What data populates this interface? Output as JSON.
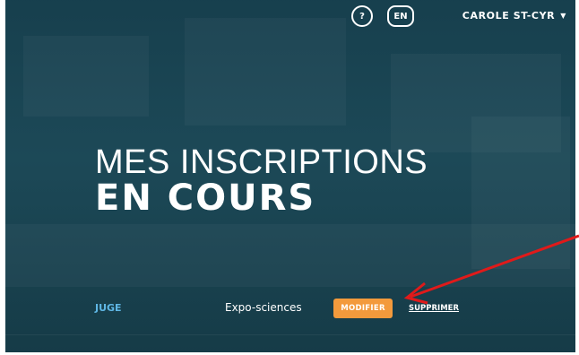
{
  "header": {
    "help_label": "?",
    "lang_label": "EN",
    "user_name": "CAROLE ST-CYR",
    "user_caret": "▼"
  },
  "hero": {
    "title_light": "MES INSCRIPTIONS",
    "title_bold": "EN COURS"
  },
  "registration": {
    "role": "JUGE",
    "event": "Expo-sciences",
    "modify_label": "MODIFIER",
    "delete_label": "SUPPRIMER"
  },
  "colors": {
    "background": "#1f4f5f",
    "accent_orange": "#f39a3c",
    "role_blue": "#5fb7e5",
    "annotation_red": "#e01a1a"
  }
}
